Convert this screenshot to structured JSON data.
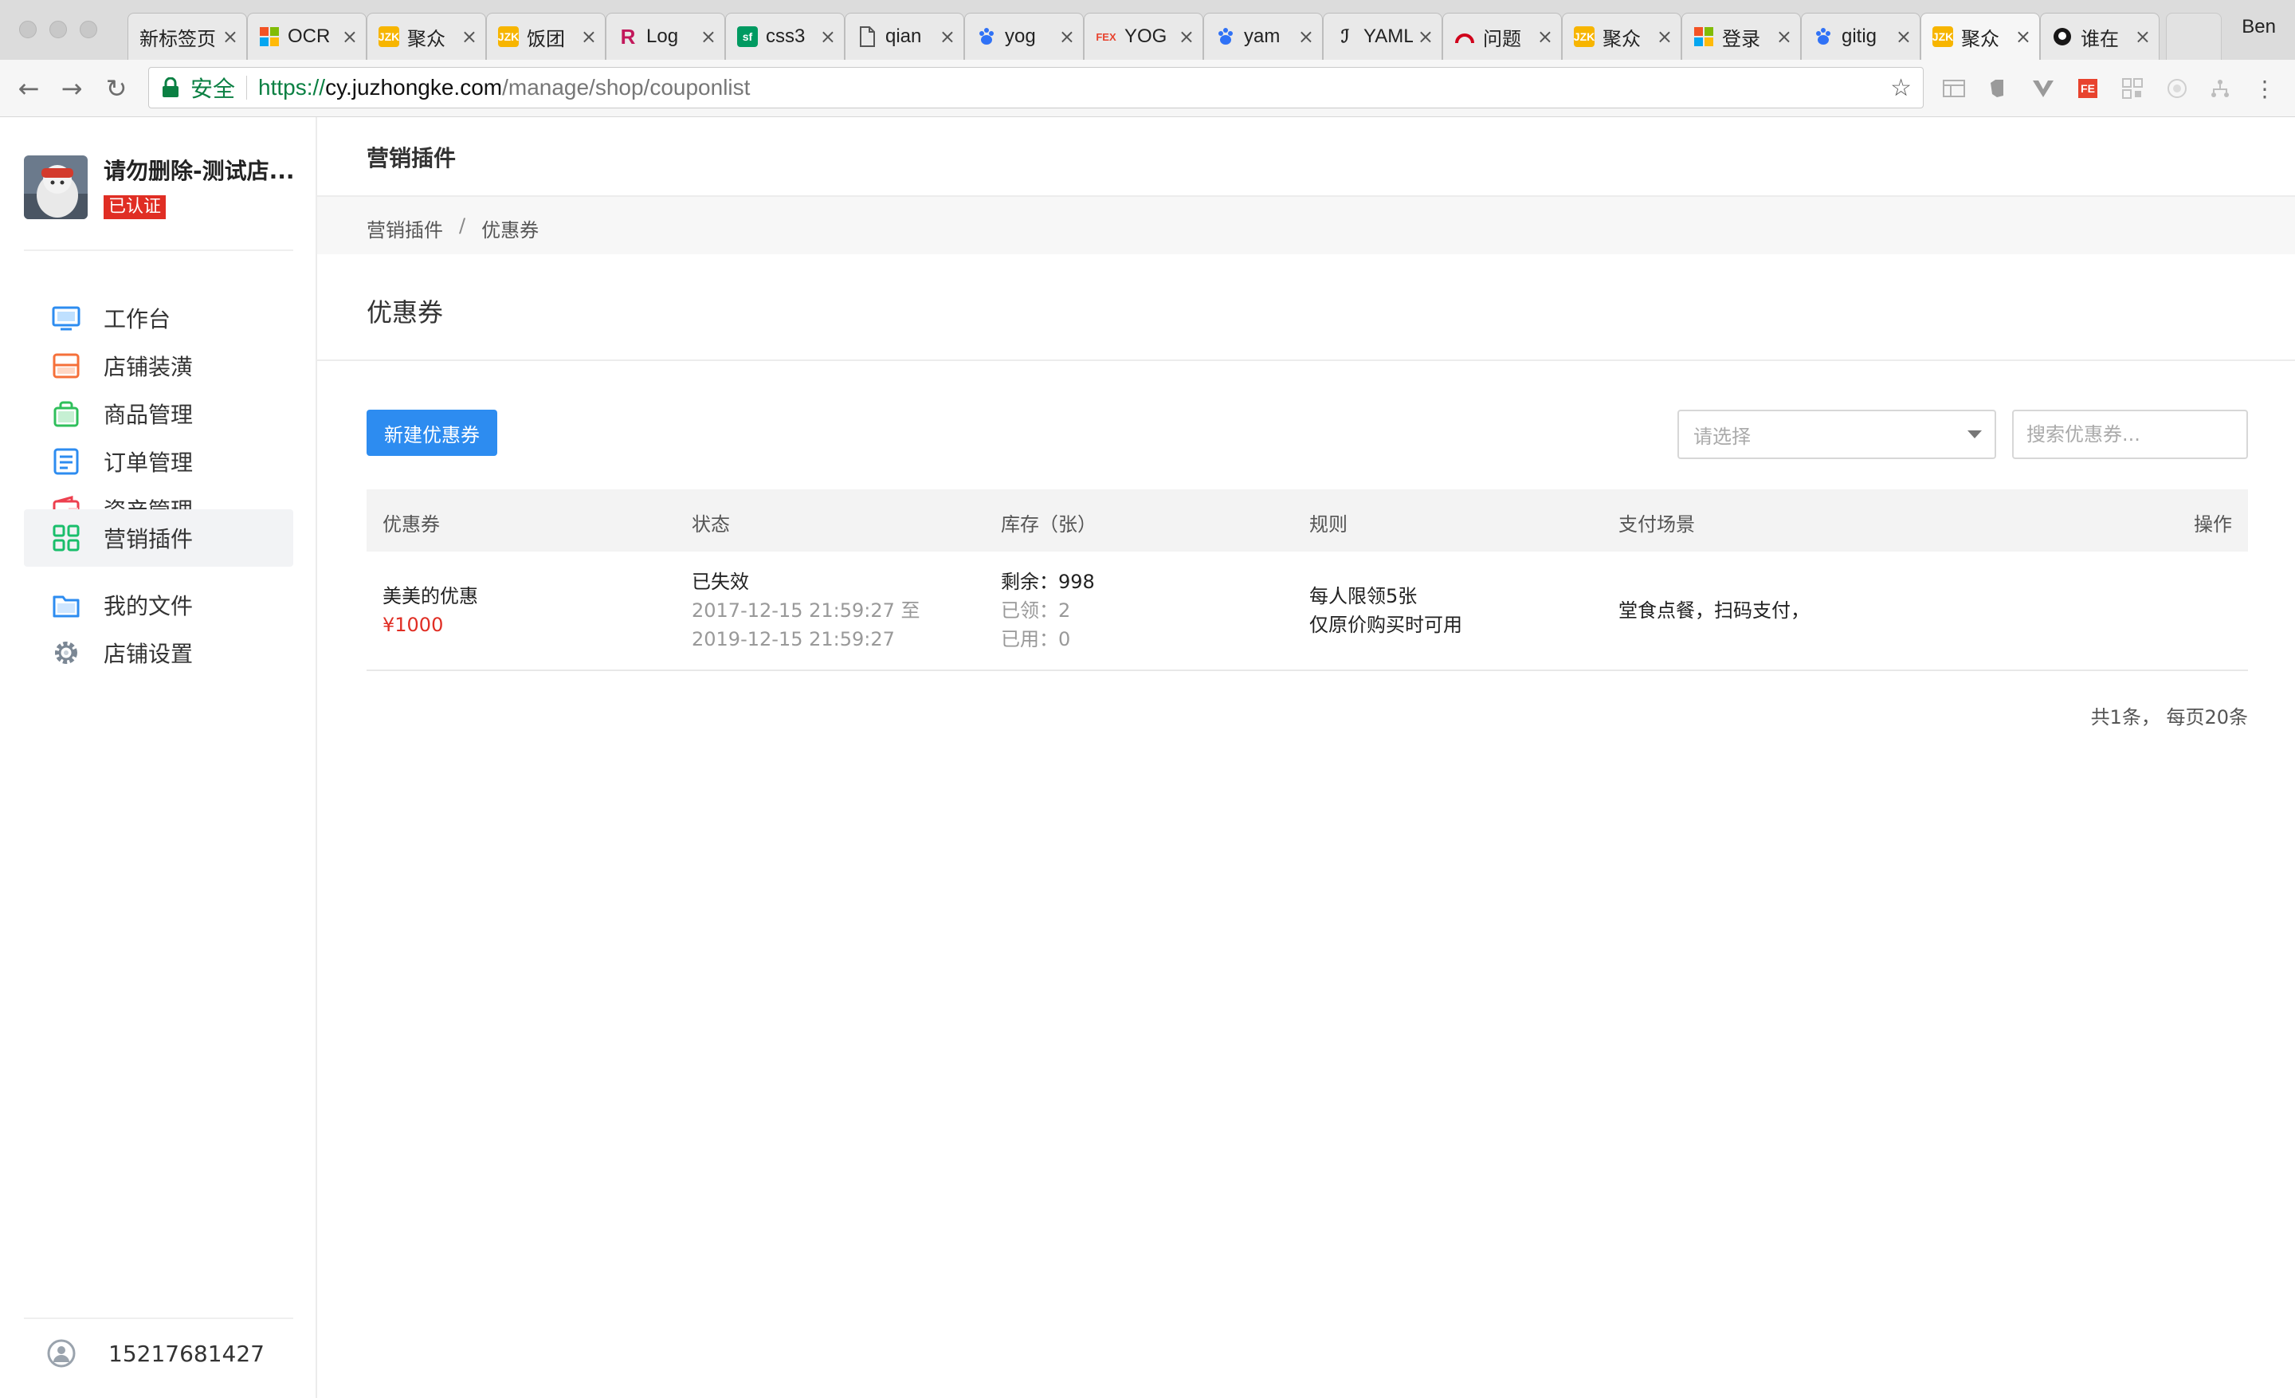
{
  "browser": {
    "tabs": [
      {
        "title": "新标签页",
        "favicon": "blank"
      },
      {
        "title": "OCR",
        "favicon": "windows"
      },
      {
        "title": "聚众",
        "favicon": "jzk"
      },
      {
        "title": "饭团",
        "favicon": "jzk"
      },
      {
        "title": "Log",
        "favicon": "r"
      },
      {
        "title": "css3",
        "favicon": "sf"
      },
      {
        "title": "qian",
        "favicon": "file"
      },
      {
        "title": "yog",
        "favicon": "baidu"
      },
      {
        "title": "YOG",
        "favicon": "fex"
      },
      {
        "title": "yam",
        "favicon": "baidu"
      },
      {
        "title": "YAML",
        "favicon": "yam"
      },
      {
        "title": "问题",
        "favicon": "gauge"
      },
      {
        "title": "聚众",
        "favicon": "jzk"
      },
      {
        "title": "登录",
        "favicon": "windows"
      },
      {
        "title": "gitig",
        "favicon": "baidu"
      },
      {
        "title": "聚众",
        "favicon": "jzk",
        "active": true
      },
      {
        "title": "谁在",
        "favicon": "github"
      }
    ],
    "profile_name": "Ben",
    "secure_label": "安全",
    "url_scheme": "https://",
    "url_host": "cy.juzhongke.com",
    "url_path": "/manage/shop/couponlist"
  },
  "sidebar": {
    "shop_name": "请勿删除-测试店...",
    "verified_badge": "已认证",
    "items": [
      {
        "label": "工作台",
        "icon": "monitor-icon",
        "color": "#2d8cf0"
      },
      {
        "label": "店铺装潢",
        "icon": "store-icon",
        "color": "#f5703a"
      },
      {
        "label": "商品管理",
        "icon": "bag-icon",
        "color": "#2fbf5b"
      },
      {
        "label": "订单管理",
        "icon": "order-list-icon",
        "color": "#2d8cf0"
      },
      {
        "label": "资产管理",
        "icon": "wallet-icon",
        "color": "#ed3f4e"
      },
      {
        "label": "营销插件",
        "icon": "grid-apps-icon",
        "color": "#19be6b",
        "active": true
      },
      {
        "label": "我的文件",
        "icon": "folder-icon",
        "color": "#2d8cf0"
      },
      {
        "label": "店铺设置",
        "icon": "gear-icon",
        "color": "#7b8794"
      }
    ],
    "user_phone": "15217681427"
  },
  "page": {
    "header_title": "营销插件",
    "breadcrumb": {
      "parent": "营销插件",
      "separator": "/",
      "current": "优惠券"
    },
    "section_title": "优惠券",
    "new_button": "新建优惠券",
    "select_placeholder": "请选择",
    "search_placeholder": "搜索优惠券...",
    "table": {
      "headers": [
        "优惠券",
        "状态",
        "库存（张）",
        "规则",
        "支付场景",
        "操作"
      ],
      "rows": [
        {
          "name": "美美的优惠",
          "price": "¥1000",
          "status": "已失效",
          "start": "2017-12-15 21:59:27 至",
          "end": "2019-12-15 21:59:27",
          "remaining": "剩余：998",
          "claimed": "已领：2",
          "used": "已用：0",
          "rule_1": "每人限领5张",
          "rule_2": "仅原价购买时可用",
          "scenes": "堂食点餐，扫码支付，"
        }
      ]
    },
    "pagination": "共1条， 每页20条"
  },
  "colors": {
    "primary": "#2d8cf0",
    "danger": "#e02e24",
    "secure_green": "#0b8043"
  }
}
